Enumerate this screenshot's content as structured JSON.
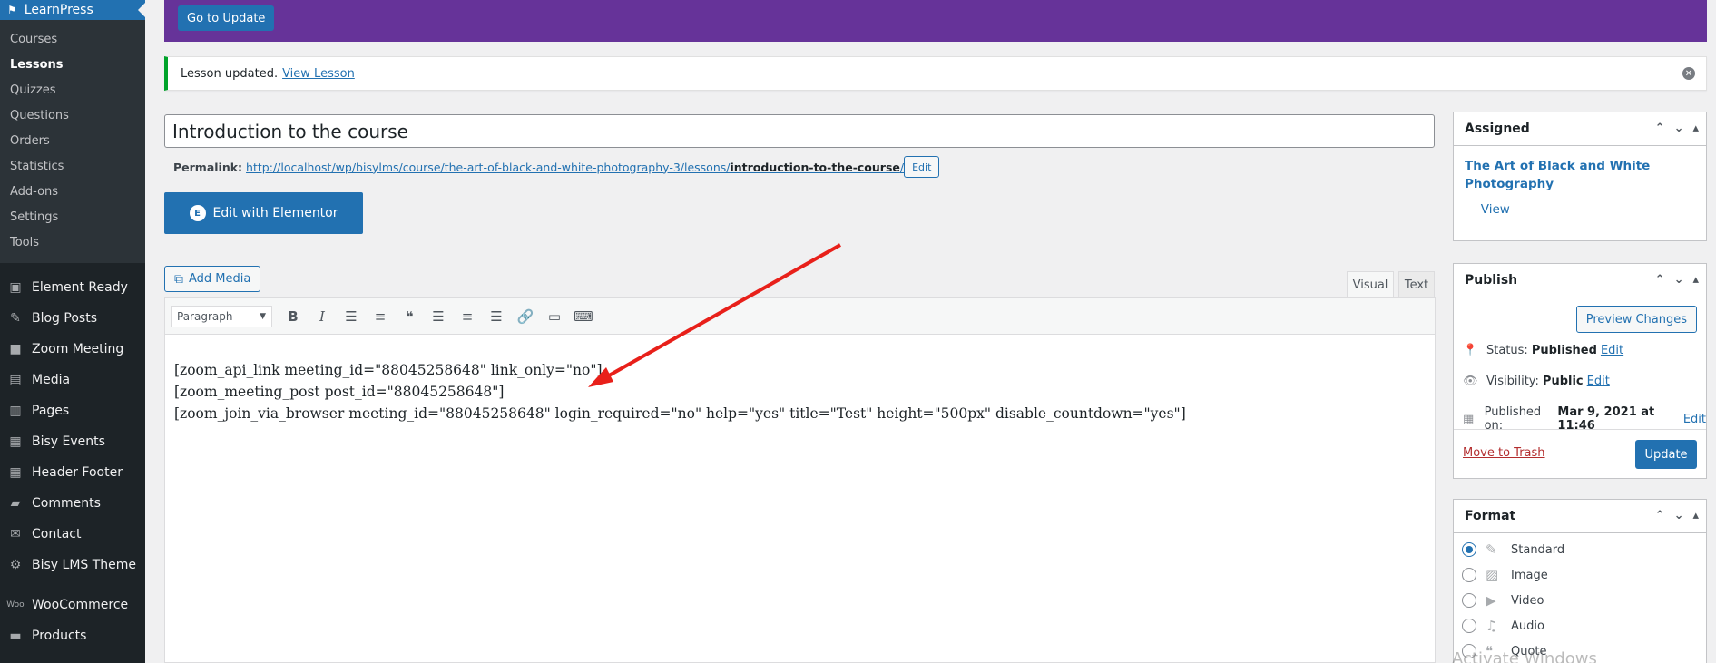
{
  "sidebar": {
    "current_menu": "LearnPress",
    "sub_items": [
      {
        "label": "Courses"
      },
      {
        "label": "Lessons",
        "active": true
      },
      {
        "label": "Quizzes"
      },
      {
        "label": "Questions"
      },
      {
        "label": "Orders"
      },
      {
        "label": "Statistics"
      },
      {
        "label": "Add-ons"
      },
      {
        "label": "Settings"
      },
      {
        "label": "Tools"
      }
    ],
    "menu_items": [
      {
        "label": "Element Ready",
        "icon": "element-ready-icon"
      },
      {
        "label": "Blog Posts",
        "icon": "pin-icon"
      },
      {
        "label": "Zoom Meeting",
        "icon": "video-icon"
      },
      {
        "label": "Media",
        "icon": "media-icon"
      },
      {
        "label": "Pages",
        "icon": "pages-icon"
      },
      {
        "label": "Bisy Events",
        "icon": "document-icon"
      },
      {
        "label": "Header Footer",
        "icon": "document-icon"
      },
      {
        "label": "Comments",
        "icon": "comment-icon"
      },
      {
        "label": "Contact",
        "icon": "mail-icon"
      },
      {
        "label": "Bisy LMS Theme",
        "icon": "gear-icon"
      },
      {
        "label": "WooCommerce",
        "icon": "woo-icon"
      },
      {
        "label": "Products",
        "icon": "archive-icon"
      }
    ]
  },
  "banner": {
    "button_label": "Go to Update",
    "color": "#663399"
  },
  "notice": {
    "text": "Lesson updated.",
    "link": "View Lesson"
  },
  "post": {
    "title": "Introduction to the course",
    "permalink_label": "Permalink:",
    "permalink_base": "http://localhost/wp/bisylms/course/the-art-of-black-and-white-photography-3/lessons/",
    "permalink_slug": "introduction-to-the-course",
    "permalink_trailing": "/",
    "permalink_edit": "Edit",
    "elementor_button": "Edit with Elementor"
  },
  "editor": {
    "add_media": "Add Media",
    "tab_visual": "Visual",
    "tab_text": "Text",
    "format_select": "Paragraph",
    "content_lines": [
      "[zoom_api_link meeting_id=\"88045258648\" link_only=\"no\"]",
      "[zoom_meeting_post post_id=\"88045258648\"]",
      "[zoom_join_via_browser meeting_id=\"88045258648\" login_required=\"no\" help=\"yes\" title=\"Test\" height=\"500px\" disable_countdown=\"yes\"]"
    ]
  },
  "assigned": {
    "title": "Assigned",
    "course": "The Art of Black and White Photography",
    "view": "— View"
  },
  "publish": {
    "title": "Publish",
    "preview": "Preview Changes",
    "status_label": "Status:",
    "status_value": "Published",
    "visibility_label": "Visibility:",
    "visibility_value": "Public",
    "published_label": "Published on:",
    "published_value": "Mar 9, 2021 at 11:46",
    "edit": "Edit",
    "trash": "Move to Trash",
    "update": "Update"
  },
  "format": {
    "title": "Format",
    "options": [
      {
        "label": "Standard",
        "checked": true,
        "icon": "pin-icon"
      },
      {
        "label": "Image",
        "checked": false,
        "icon": "image-icon"
      },
      {
        "label": "Video",
        "checked": false,
        "icon": "video-icon"
      },
      {
        "label": "Audio",
        "checked": false,
        "icon": "audio-icon"
      },
      {
        "label": "Quote",
        "checked": false,
        "icon": "quote-icon"
      }
    ]
  },
  "watermark": "Activate Windows",
  "colors": {
    "accent": "#2271b1",
    "annotation_arrow": "#e8201a"
  }
}
